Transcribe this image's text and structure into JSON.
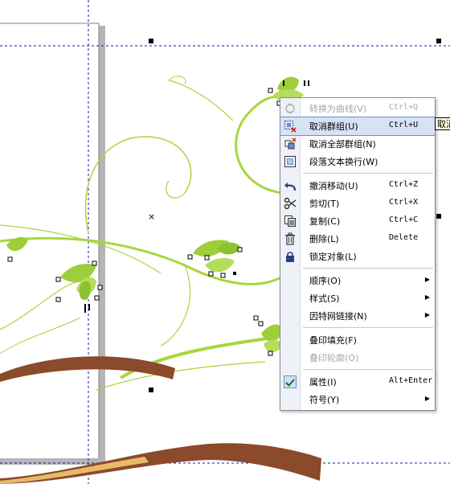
{
  "menu": {
    "items": [
      {
        "label": "转换为曲线(V)",
        "shortcut": "Ctrl+Q",
        "disabled": true,
        "icon": "convert-curve-icon"
      },
      {
        "label": "取消群组(U)",
        "shortcut": "Ctrl+U",
        "highlighted": true,
        "icon": "ungroup-icon"
      },
      {
        "label": "取消全部群组(N)",
        "shortcut": "",
        "icon": "ungroup-all-icon"
      },
      {
        "label": "段落文本换行(W)",
        "shortcut": "",
        "icon": "wrap-text-icon"
      },
      {
        "label": "撤消移动(U)",
        "shortcut": "Ctrl+Z",
        "icon": "undo-icon"
      },
      {
        "label": "剪切(T)",
        "shortcut": "Ctrl+X",
        "icon": "scissors-icon"
      },
      {
        "label": "复制(C)",
        "shortcut": "Ctrl+C",
        "icon": "copy-icon"
      },
      {
        "label": "删除(L)",
        "shortcut": "Delete",
        "icon": "trash-icon"
      },
      {
        "label": "锁定对象(L)",
        "shortcut": "",
        "icon": "lock-icon"
      },
      {
        "label": "顺序(O)",
        "shortcut": "",
        "submenu": true
      },
      {
        "label": "样式(S)",
        "shortcut": "",
        "submenu": true
      },
      {
        "label": "因特网链接(N)",
        "shortcut": "",
        "submenu": true
      },
      {
        "label": "叠印填充(F)",
        "shortcut": ""
      },
      {
        "label": "叠印轮廓(O)",
        "shortcut": "",
        "disabled": true
      },
      {
        "label": "属性(I)",
        "shortcut": "Alt+Enter",
        "icon": "checkmark-icon"
      },
      {
        "label": "符号(Y)",
        "shortcut": "",
        "submenu": true
      }
    ]
  },
  "tooltip": {
    "text": "取消"
  },
  "colors": {
    "leaf": "#9ccf3a",
    "stem": "#a8d63c",
    "ribbon": "#8b4a2b",
    "ribbon_light": "#e8b96a",
    "guide": "#1a1aa0",
    "highlight": "#d7e2f5"
  }
}
